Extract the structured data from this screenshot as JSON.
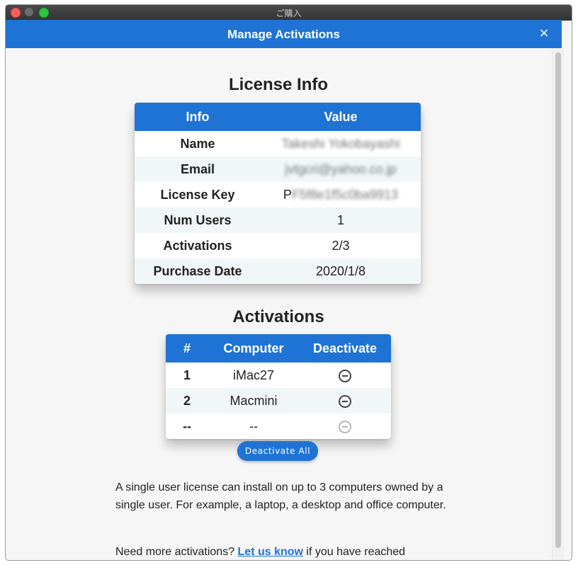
{
  "titlebar": {
    "title": "ご購入"
  },
  "header": {
    "title": "Manage Activations",
    "close_label": "×"
  },
  "license": {
    "heading": "License Info",
    "columns": [
      "Info",
      "Value"
    ],
    "rows": [
      {
        "label": "Name",
        "value": "Takeshi Yokobayashi",
        "blurred": true
      },
      {
        "label": "Email",
        "value": "jvtgcri@yahoo.co.jp",
        "blurred": true
      },
      {
        "label": "License Key",
        "value_prefix": "P",
        "value": "F5f8e1f5c0ba9913",
        "blurred": true
      },
      {
        "label": "Num Users",
        "value": "1"
      },
      {
        "label": "Activations",
        "value": "2/3"
      },
      {
        "label": "Purchase Date",
        "value": "2020/1/8"
      }
    ]
  },
  "activations": {
    "heading": "Activations",
    "columns": [
      "#",
      "Computer",
      "Deactivate"
    ],
    "rows": [
      {
        "num": "1",
        "computer": "iMac27",
        "icon": "minus-circle-icon",
        "enabled": true
      },
      {
        "num": "2",
        "computer": "Macmini",
        "icon": "minus-circle-icon",
        "enabled": true
      },
      {
        "num": "--",
        "computer": "--",
        "icon": "minus-circle-icon",
        "enabled": false
      }
    ],
    "deactivate_all_label": "Deactivate All"
  },
  "info": {
    "paragraph1": "A single user license can install on up to 3 computers owned by a single user. For example, a laptop, a desktop and office computer.",
    "paragraph2_before": "Need more activations? ",
    "paragraph2_link": "Let us know",
    "paragraph2_after": " if you have reached"
  },
  "colors": {
    "accent": "#1f73d4",
    "alt_row": "#f1f6f8",
    "close_light": "#ff5f57",
    "max_light": "#28c840"
  }
}
